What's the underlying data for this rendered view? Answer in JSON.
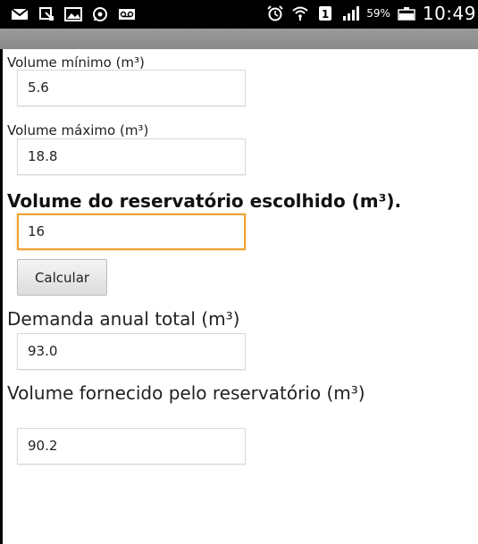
{
  "status_bar": {
    "icons_left": [
      "mail-icon",
      "download-icon",
      "image-icon",
      "whatsapp-icon",
      "voicemail-icon"
    ],
    "icons_right": [
      "alarm-icon",
      "wifi-icon",
      "sim-icon",
      "signal-icon",
      "battery-icon"
    ],
    "battery_percent": "59%",
    "time": "10:49"
  },
  "form": {
    "volume_min": {
      "label": "Volume mínimo (m³)",
      "value": "5.6"
    },
    "volume_max": {
      "label": "Volume máximo (m³)",
      "value": "18.8"
    },
    "volume_chosen": {
      "label": "Volume do reservatório escolhido (m³).",
      "value": "16"
    },
    "calculate_label": "Calcular",
    "annual_demand": {
      "label": "Demanda anual total (m³)",
      "value": "93.0"
    },
    "supplied_volume": {
      "label": "Volume fornecido pelo reservatório (m³)",
      "value": "90.2"
    }
  },
  "colors": {
    "focus_border": "#f0a030",
    "action_bar": "#8f8f8f",
    "status_bar": "#000000"
  }
}
